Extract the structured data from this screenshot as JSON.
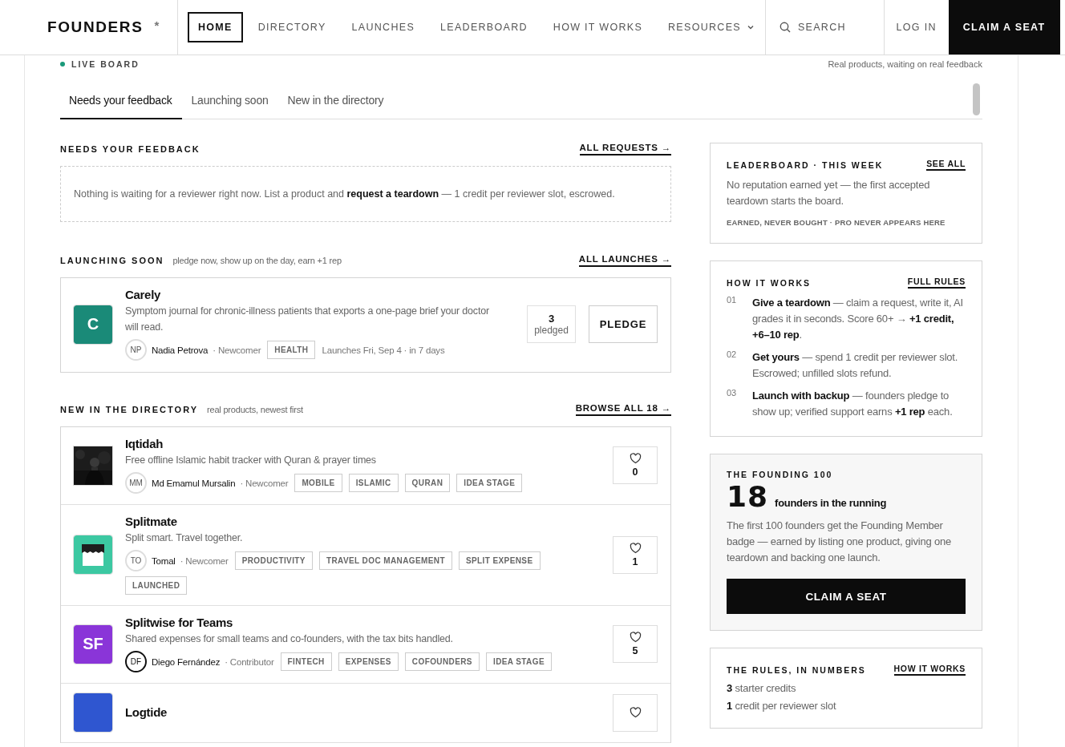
{
  "header": {
    "logo": "FOUNDERS",
    "logo_mark": "*",
    "nav": [
      {
        "label": "HOME",
        "selected": true,
        "has_menu": false
      },
      {
        "label": "DIRECTORY",
        "selected": false,
        "has_menu": false
      },
      {
        "label": "LAUNCHES",
        "selected": false,
        "has_menu": false
      },
      {
        "label": "LEADERBOARD",
        "selected": false,
        "has_menu": false
      },
      {
        "label": "HOW IT WORKS",
        "selected": false,
        "has_menu": false
      },
      {
        "label": "RESOURCES",
        "selected": false,
        "has_menu": true
      }
    ],
    "search": "SEARCH",
    "login": "LOG IN",
    "cta": "CLAIM A SEAT"
  },
  "live": {
    "label": "LIVE BOARD",
    "color": "#1a9a7a",
    "note": "Real products, waiting on real feedback"
  },
  "tabs": [
    {
      "label": "Needs your feedback",
      "selected": true
    },
    {
      "label": "Launching soon",
      "selected": false
    },
    {
      "label": "New in the directory",
      "selected": false
    }
  ],
  "feedback": {
    "title": "NEEDS YOUR FEEDBACK",
    "link": "ALL REQUESTS →",
    "empty": "Nothing is waiting for a reviewer right now. List a product and **request a teardown** — 1 credit per reviewer slot, escrowed."
  },
  "launching": {
    "title": "LAUNCHING SOON",
    "note": "pledge now, show up on the day, earn +1 rep",
    "link": "ALL LAUNCHES →",
    "items": [
      {
        "name": "Carely",
        "logo": {
          "kind": "letter",
          "text": "C",
          "color": "#1a8a78"
        },
        "description": "Symptom journal for chronic-illness patients that exports a one-page brief your doctor will read.",
        "author": {
          "initials": "NP",
          "name": "Nadia Petrova",
          "role": "· Newcomer",
          "emphasized": false
        },
        "tags": [
          "HEALTH"
        ],
        "date": "Launches Fri, Sep 4 · in 7 days",
        "pledges": "3",
        "pledges_label": "pledged",
        "button": "PLEDGE"
      }
    ]
  },
  "directory": {
    "title": "NEW IN THE DIRECTORY",
    "note": "real products, newest first",
    "link": "BROWSE ALL 18 →",
    "items": [
      {
        "name": "Iqtidah",
        "description": "Free offline Islamic habit tracker with Quran & prayer times",
        "author": {
          "initials": "MM",
          "name": "Md Emamul Mursalin",
          "role": "· Newcomer",
          "emphasized": false
        },
        "tags": [
          "MOBILE",
          "ISLAMIC",
          "QURAN",
          "IDEA STAGE"
        ],
        "likes": "0"
      },
      {
        "name": "Splitmate",
        "logo": {
          "kind": "storefront",
          "color": "#3cc8a2"
        },
        "description": "Split smart. Travel together.",
        "author": {
          "initials": "TO",
          "name": "Tomal",
          "role": "· Newcomer",
          "emphasized": false
        },
        "tags": [
          "PRODUCTIVITY",
          "TRAVEL DOC MANAGEMENT",
          "SPLIT EXPENSE",
          "LAUNCHED"
        ],
        "likes": "1"
      },
      {
        "name": "Splitwise for Teams",
        "logo": {
          "kind": "letter",
          "text": "SF",
          "color": "#8a35d8"
        },
        "description": "Shared expenses for small teams and co-founders, with the tax bits handled.",
        "author": {
          "initials": "DF",
          "name": "Diego Fernández",
          "role": "· Contributor",
          "emphasized": true
        },
        "tags": [
          "FINTECH",
          "EXPENSES",
          "COFOUNDERS",
          "IDEA STAGE"
        ],
        "likes": "5"
      },
      {
        "name": "Logtide",
        "logo": {
          "kind": "plain",
          "color": "#2f56d0"
        }
      }
    ]
  },
  "leaderboard": {
    "title": "LEADERBOARD · THIS WEEK",
    "link": "SEE ALL",
    "text": "No reputation earned yet — the first accepted teardown starts the board.",
    "footnote": "EARNED, NEVER BOUGHT · PRO NEVER APPEARS HERE"
  },
  "how_it_works": {
    "title": "HOW IT WORKS",
    "link": "FULL RULES",
    "steps": [
      {
        "number": "01",
        "text": "**Give a teardown** — claim a request, write it, AI grades it in seconds. Score 60+ → **+1 credit, +6–10 rep**."
      },
      {
        "number": "02",
        "text": "**Get yours** — spend 1 credit per reviewer slot. Escrowed; unfilled slots refund."
      },
      {
        "number": "03",
        "text": "**Launch with backup** — founders pledge to show up; verified support earns **+1 rep** each."
      }
    ]
  },
  "founding": {
    "title": "THE FOUNDING 100",
    "count": "18",
    "count_label": "founders in the running",
    "text": "The first 100 founders get the Founding Member badge — earned by listing one product, giving one teardown and backing one launch.",
    "button": "CLAIM A SEAT"
  },
  "rules": {
    "title": "THE RULES, IN NUMBERS",
    "link": "HOW IT WORKS",
    "items": [
      "**3** starter credits",
      "**1** credit per reviewer slot"
    ]
  }
}
